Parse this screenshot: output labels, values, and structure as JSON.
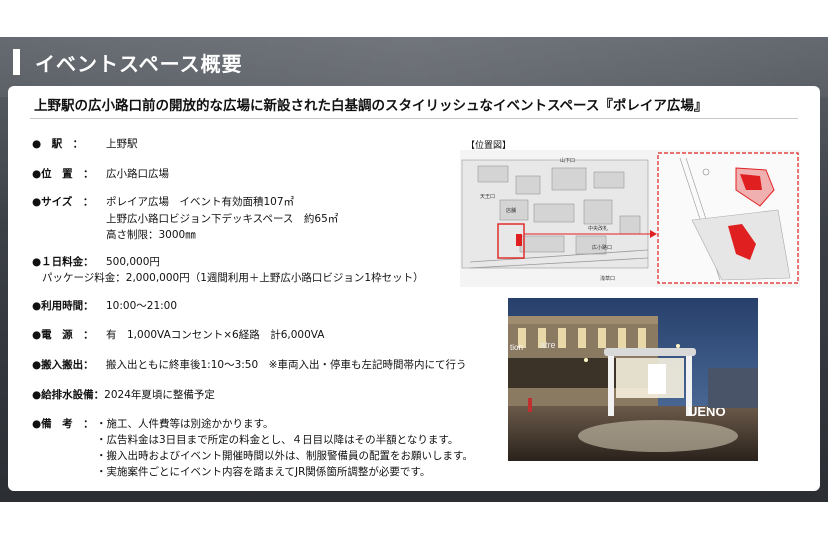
{
  "header": {
    "title": "イベントスペース概要"
  },
  "card": {
    "subtitle": "上野駅の広小路口前の開放的な広場に新設された白基調のスタイリッシュなイベントスペース『ポレイア広場』",
    "rows": {
      "station": {
        "label": "●　駅　：",
        "value": "上野駅"
      },
      "location": {
        "label": "●位　置　：",
        "value": "広小路口広場"
      },
      "size": {
        "label": "●サイズ　：",
        "line1": "ポレイア広場　イベント有効面積107㎡",
        "line2": "上野広小路口ビジョン下デッキスペース　約65㎡",
        "line3": "高さ制限：3000㎜"
      },
      "fee": {
        "label": "●１日料金：",
        "value": "500,000円",
        "line2": "パッケージ料金：2,000,000円（1週間利用＋上野広小路口ビジョン1枠セット）"
      },
      "hours": {
        "label": "●利用時間：",
        "value": "10:00～21:00"
      },
      "power": {
        "label": "●電　源　：",
        "value": "有　1,000VAコンセント×6経路　計6,000VA"
      },
      "loading": {
        "label": "●搬入搬出：",
        "value": "搬入出ともに終車後1:10～3:50　※車両入出・停車も左記時間帯内にて行う"
      },
      "water": {
        "label": "●給排水設備：",
        "value": "2024年夏頃に整備予定"
      },
      "notes": {
        "label": "●備　考　：",
        "items": [
          "・施工、人件費等は別途かかります。",
          "・広告料金は3日目まで所定の料金とし、４日目以降はその半額となります。",
          "・搬入出時およびイベント開催時間以外は、制服警備員の配置をお願いします。",
          "・実施案件ごとにイベント内容を踏まえてJR関係箇所調整が必要です。"
        ]
      }
    },
    "map": {
      "label": "【位置図】",
      "texts": {
        "yamashita": "山下口",
        "tenkou": "天王口",
        "hirokouji": "広小路口",
        "asakusa": "浅草口",
        "central": "中央改札",
        "shop": "店舗"
      }
    },
    "photo": {
      "sign1": "tion",
      "sign2": "atre",
      "ueno": "UENO"
    }
  },
  "colors": {
    "title_bg": "#3f434a",
    "accent_red": "#e02020"
  }
}
